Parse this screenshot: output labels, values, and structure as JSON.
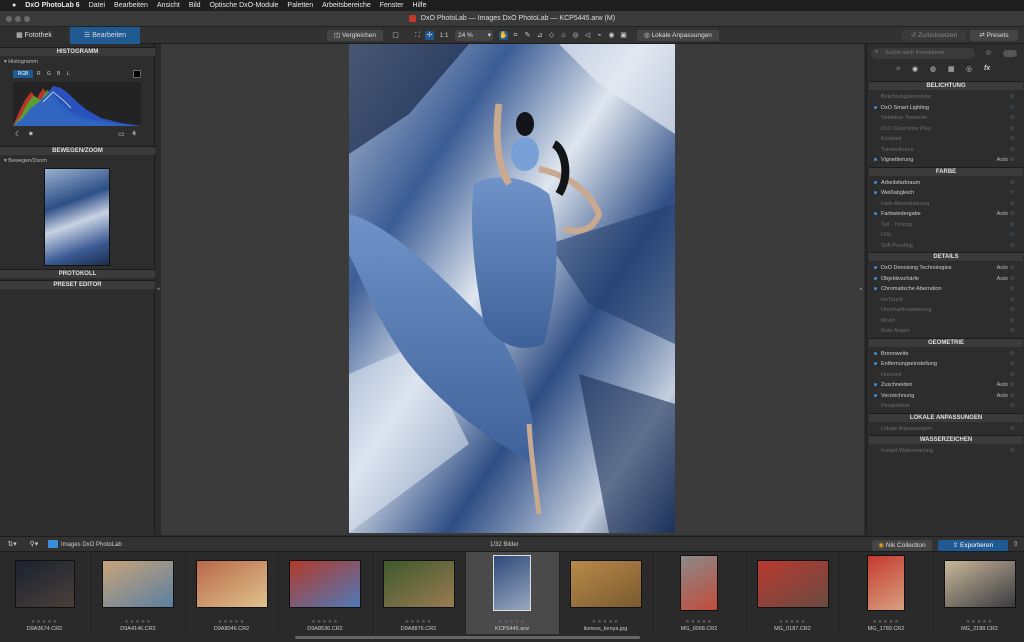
{
  "menubar": {
    "items": [
      "DxO PhotoLab 6",
      "Datei",
      "Bearbeiten",
      "Ansicht",
      "Bild",
      "Optische DxO-Module",
      "Paletten",
      "Arbeitsbereiche",
      "Fenster",
      "Hilfe"
    ]
  },
  "window": {
    "title": "DxO PhotoLab — Images DxO PhotoLab — KCP5445.arw (M)"
  },
  "toolbar": {
    "tabs": [
      "Fotothek",
      "Bearbeiten"
    ],
    "compare_label": "Vergleichen",
    "zoom_ratio": "1:1",
    "zoom_value": "24 %",
    "local_adjust_label": "Lokale Anpassungen",
    "reset_label": "Zurücksetzen",
    "presets_label": "Presets"
  },
  "left": {
    "histogram_title": "HISTOGRAMM",
    "histogram_sub": "Histogramm",
    "channels": [
      "RGB",
      "R",
      "G",
      "B",
      "L"
    ],
    "move_zoom_title": "BEWEGEN/ZOOM",
    "move_zoom_sub": "Bewegen/Zoom",
    "history_title": "PROTOKOLL",
    "preset_editor_title": "PRESET EDITOR"
  },
  "right": {
    "search_placeholder": "Suche nach Korrekturen",
    "sections": [
      {
        "title": "BELICHTUNG",
        "rows": [
          {
            "label": "Belichtungskorrektur",
            "active": false,
            "auto": "",
            "blue": false
          },
          {
            "label": "DxO Smart Lighting",
            "active": true,
            "auto": "",
            "blue": true
          },
          {
            "label": "Selektive Tonwerte",
            "active": false,
            "auto": "",
            "blue": false
          },
          {
            "label": "DxO ClearView Plus",
            "active": false,
            "auto": "",
            "blue": false
          },
          {
            "label": "Kontrast",
            "active": false,
            "auto": "",
            "blue": false
          },
          {
            "label": "Tonwertkurve",
            "active": false,
            "auto": "",
            "blue": false
          },
          {
            "label": "Vignettierung",
            "active": true,
            "auto": "Auto",
            "blue": false
          }
        ]
      },
      {
        "title": "FARBE",
        "rows": [
          {
            "label": "Arbeitsfarbraum",
            "active": true,
            "auto": "",
            "blue": false
          },
          {
            "label": "Weißabgleich",
            "active": true,
            "auto": "",
            "blue": true
          },
          {
            "label": "Farb-Akzentuierung",
            "active": false,
            "auto": "",
            "blue": false
          },
          {
            "label": "Farbwiedergabe",
            "active": true,
            "auto": "Auto",
            "blue": false
          },
          {
            "label": "Teil - Tonung",
            "active": false,
            "auto": "",
            "blue": false
          },
          {
            "label": "HSL",
            "active": false,
            "auto": "",
            "blue": true
          },
          {
            "label": "Soft Proofing",
            "active": false,
            "auto": "",
            "blue": false
          }
        ]
      },
      {
        "title": "DETAILS",
        "rows": [
          {
            "label": "DxO Denoising Technologies",
            "active": true,
            "auto": "Auto",
            "blue": false
          },
          {
            "label": "Objektivschärfe",
            "active": true,
            "auto": "Auto",
            "blue": false
          },
          {
            "label": "Chromatische Aberration",
            "active": true,
            "auto": "",
            "blue": false
          },
          {
            "label": "ReTouch",
            "active": false,
            "auto": "",
            "blue": false
          },
          {
            "label": "Unscharfmaskierung",
            "active": false,
            "auto": "",
            "blue": false
          },
          {
            "label": "Moiré",
            "active": false,
            "auto": "",
            "blue": false
          },
          {
            "label": "Rote Augen",
            "active": false,
            "auto": "",
            "blue": false
          }
        ]
      },
      {
        "title": "GEOMETRIE",
        "rows": [
          {
            "label": "Brennweite",
            "active": true,
            "auto": "",
            "blue": false
          },
          {
            "label": "Entfernungseinstellung",
            "active": true,
            "auto": "",
            "blue": false
          },
          {
            "label": "Horizont",
            "active": false,
            "auto": "",
            "blue": false
          },
          {
            "label": "Zuschneiden",
            "active": true,
            "auto": "Auto",
            "blue": false
          },
          {
            "label": "Verzeichnung",
            "active": true,
            "auto": "Auto",
            "blue": false
          },
          {
            "label": "Perspektive",
            "active": false,
            "auto": "",
            "blue": false
          }
        ]
      },
      {
        "title": "LOKALE ANPASSUNGEN",
        "rows": [
          {
            "label": "Lokale Anpassungen",
            "active": false,
            "auto": "",
            "blue": false
          }
        ]
      },
      {
        "title": "WASSERZEICHEN",
        "rows": [
          {
            "label": "Instant Watermarking",
            "active": false,
            "auto": "",
            "blue": false
          }
        ]
      }
    ]
  },
  "filmbar": {
    "folder": "Images DxO PhotoLab",
    "count": "1/32 Bilder",
    "nik_label": "Nik Collection",
    "export_label": "Exportieren"
  },
  "film": {
    "thumbs": [
      {
        "name": "D9A3674.CR2",
        "colors": [
          "#1b2230",
          "#4a3f3a"
        ],
        "w": 60,
        "h": 48
      },
      {
        "name": "D9A4146.CR2",
        "colors": [
          "#c9a47a",
          "#5a7fa0"
        ],
        "w": 72,
        "h": 48
      },
      {
        "name": "D9A8046.CR2",
        "colors": [
          "#b8694a",
          "#e0c28c"
        ],
        "w": 72,
        "h": 48
      },
      {
        "name": "D9A8536.CR2",
        "colors": [
          "#b23a2a",
          "#4f79b8"
        ],
        "w": 72,
        "h": 48
      },
      {
        "name": "D9A8876.CR2",
        "colors": [
          "#3e5a2c",
          "#9a7a52"
        ],
        "w": 72,
        "h": 48
      },
      {
        "name": "KCP5445.arw",
        "colors": [
          "#2d4a7a",
          "#9aa8c0"
        ],
        "w": 38,
        "h": 56
      },
      {
        "name": "lioness_kenya.jpg",
        "colors": [
          "#b88a48",
          "#7a5a30"
        ],
        "w": 72,
        "h": 48
      },
      {
        "name": "MG_0068.CR2",
        "colors": [
          "#8a8a8a",
          "#c24b3a"
        ],
        "w": 38,
        "h": 56
      },
      {
        "name": "MG_0187.CR2",
        "colors": [
          "#b83a30",
          "#6a4a40"
        ],
        "w": 72,
        "h": 48
      },
      {
        "name": "MG_1789.CR2",
        "colors": [
          "#c43a30",
          "#d8a080"
        ],
        "w": 38,
        "h": 56
      },
      {
        "name": "MG_2188.CR2",
        "colors": [
          "#c9b89a",
          "#3a3a40"
        ],
        "w": 72,
        "h": 48
      }
    ]
  }
}
